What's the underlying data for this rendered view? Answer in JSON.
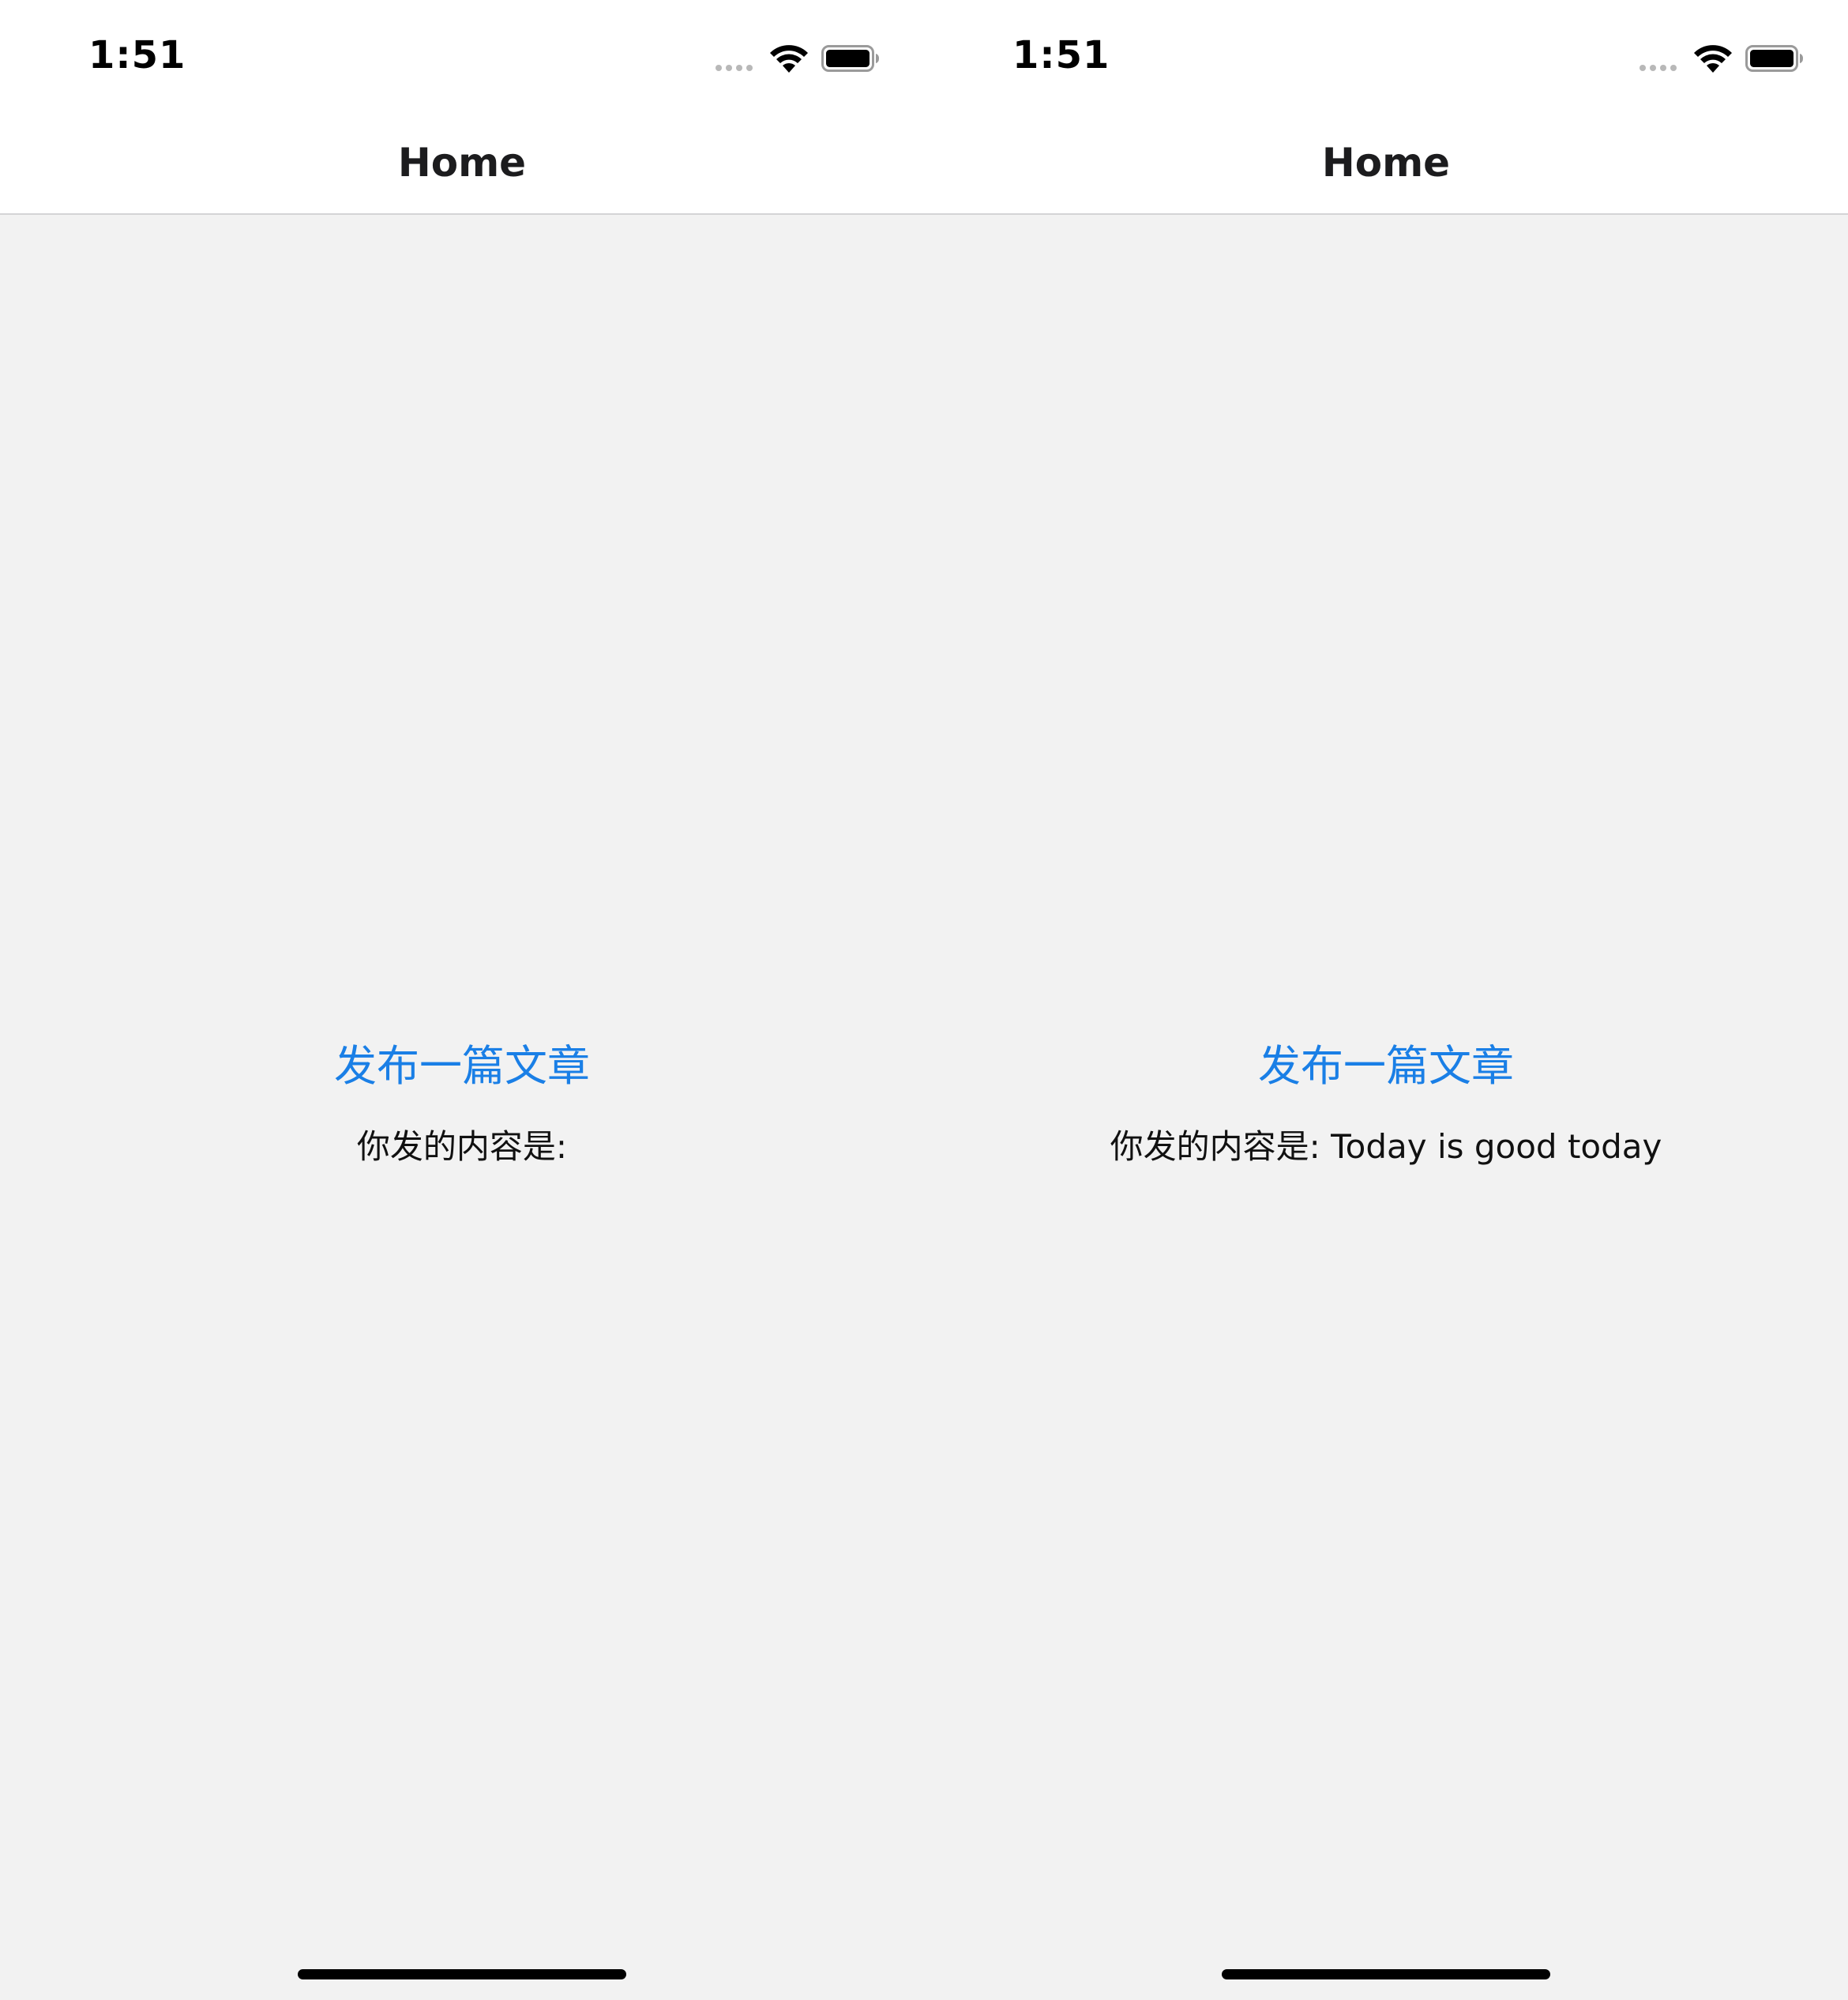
{
  "screens": [
    {
      "status_time": "1:51",
      "nav_title": "Home",
      "publish_label": "发布一篇文章",
      "content_label": "你发的内容是:",
      "content_value": ""
    },
    {
      "status_time": "1:51",
      "nav_title": "Home",
      "publish_label": "发布一篇文章",
      "content_label": "你发的内容是:",
      "content_value": "Today is good today"
    }
  ],
  "icons": {
    "signal": "cellular-signal-icon",
    "wifi": "wifi-icon",
    "battery": "battery-icon"
  },
  "colors": {
    "link_blue": "#1a7fe6",
    "background": "#f2f2f2",
    "nav_background": "#ffffff"
  }
}
